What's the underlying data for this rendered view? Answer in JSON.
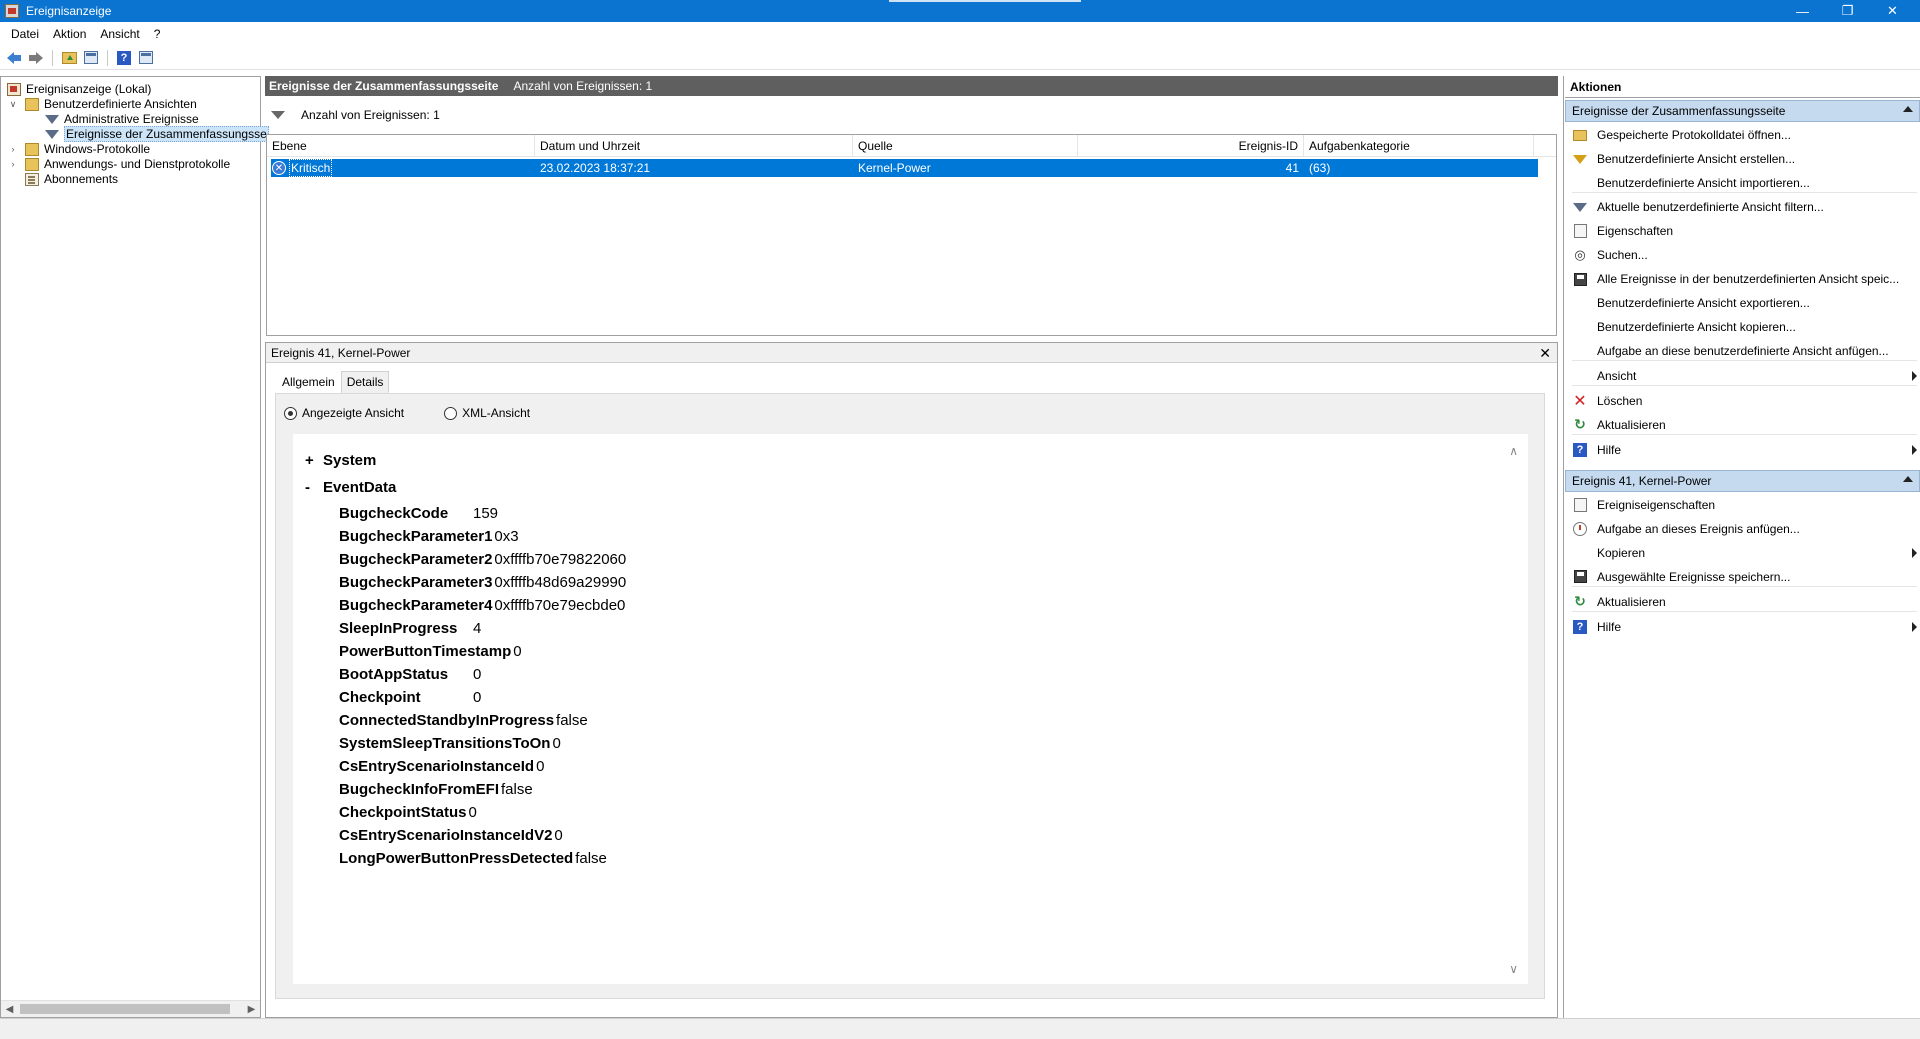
{
  "window": {
    "title": "Ereignisanzeige",
    "controls": {
      "minimize": "—",
      "maximize": "❐",
      "close": "✕"
    }
  },
  "menu": [
    "Datei",
    "Aktion",
    "Ansicht",
    "?"
  ],
  "tree": {
    "items": [
      {
        "label": "Ereignisanzeige (Lokal)",
        "icon": "computer-icon"
      },
      {
        "label": "Benutzerdefinierte Ansichten",
        "icon": "folder-icon",
        "expanded": true
      },
      {
        "label": "Administrative Ereignisse",
        "icon": "filter-icon"
      },
      {
        "label": "Ereignisse der Zusammenfassungsse",
        "icon": "filter-icon",
        "selected": true
      },
      {
        "label": "Windows-Protokolle",
        "icon": "folder-icon"
      },
      {
        "label": "Anwendungs- und Dienstprotokolle",
        "icon": "folder-icon"
      },
      {
        "label": "Abonnements",
        "icon": "log-icon"
      }
    ]
  },
  "center": {
    "header_title": "Ereignisse der Zusammenfassungsseite",
    "header_count": "Anzahl von Ereignissen: 1",
    "filter_text": "Anzahl von Ereignissen: 1",
    "columns": [
      "Ebene",
      "Datum und Uhrzeit",
      "Quelle",
      "Ereignis-ID",
      "Aufgabenkategorie"
    ],
    "rows": [
      {
        "level": "Kritisch",
        "datetime": "23.02.2023 18:37:21",
        "source": "Kernel-Power",
        "event_id": "41",
        "category": "(63)"
      }
    ]
  },
  "detail": {
    "title": "Ereignis 41, Kernel-Power",
    "tabs": [
      "Allgemein",
      "Details"
    ],
    "active_tab": "Details",
    "radio_friendly": "Angezeigte Ansicht",
    "radio_xml": "XML-Ansicht",
    "section_system": {
      "symbol": "+",
      "label": "System"
    },
    "section_eventdata": {
      "symbol": "-",
      "label": "EventData"
    },
    "eventdata": [
      {
        "key": "BugcheckCode",
        "value": "159"
      },
      {
        "key": "BugcheckParameter1",
        "value": "0x3"
      },
      {
        "key": "BugcheckParameter2",
        "value": "0xffffb70e79822060"
      },
      {
        "key": "BugcheckParameter3",
        "value": "0xffffb48d69a29990"
      },
      {
        "key": "BugcheckParameter4",
        "value": "0xffffb70e79ecbde0"
      },
      {
        "key": "SleepInProgress",
        "value": "4"
      },
      {
        "key": "PowerButtonTimestamp",
        "value": "0"
      },
      {
        "key": "BootAppStatus",
        "value": "0"
      },
      {
        "key": "Checkpoint",
        "value": "0"
      },
      {
        "key": "ConnectedStandbyInProgress",
        "value": "false"
      },
      {
        "key": "SystemSleepTransitionsToOn",
        "value": "0"
      },
      {
        "key": "CsEntryScenarioInstanceId",
        "value": "0"
      },
      {
        "key": "BugcheckInfoFromEFI",
        "value": "false"
      },
      {
        "key": "CheckpointStatus",
        "value": "0"
      },
      {
        "key": "CsEntryScenarioInstanceIdV2",
        "value": "0"
      },
      {
        "key": "LongPowerButtonPressDetected",
        "value": "false"
      }
    ]
  },
  "actions": {
    "title": "Aktionen",
    "section1": {
      "label": "Ereignisse der Zusammenfassungsseite",
      "items": [
        {
          "label": "Gespeicherte Protokolldatei öffnen...",
          "icon": "open-log-icon"
        },
        {
          "label": "Benutzerdefinierte Ansicht erstellen...",
          "icon": "create-view-icon"
        },
        {
          "label": "Benutzerdefinierte Ansicht importieren...",
          "icon": ""
        },
        {
          "label": "Aktuelle benutzerdefinierte Ansicht filtern...",
          "icon": "filter-icon"
        },
        {
          "label": "Eigenschaften",
          "icon": "properties-icon"
        },
        {
          "label": "Suchen...",
          "icon": "binoculars-icon"
        },
        {
          "label": "Alle Ereignisse in der benutzerdefinierten Ansicht speic...",
          "icon": "save-icon"
        },
        {
          "label": "Benutzerdefinierte Ansicht exportieren...",
          "icon": ""
        },
        {
          "label": "Benutzerdefinierte Ansicht kopieren...",
          "icon": ""
        },
        {
          "label": "Aufgabe an diese benutzerdefinierte Ansicht anfügen...",
          "icon": ""
        },
        {
          "label": "Ansicht",
          "icon": "",
          "submenu": true
        },
        {
          "label": "Löschen",
          "icon": "delete-icon"
        },
        {
          "label": "Aktualisieren",
          "icon": "refresh-icon"
        },
        {
          "label": "Hilfe",
          "icon": "help-icon",
          "submenu": true
        }
      ]
    },
    "section2": {
      "label": "Ereignis 41, Kernel-Power",
      "items": [
        {
          "label": "Ereigniseigenschaften",
          "icon": "properties-icon"
        },
        {
          "label": "Aufgabe an dieses Ereignis anfügen...",
          "icon": "attach-task-icon"
        },
        {
          "label": "Kopieren",
          "icon": "",
          "submenu": true
        },
        {
          "label": "Ausgewählte Ereignisse speichern...",
          "icon": "save-icon"
        },
        {
          "label": "Aktualisieren",
          "icon": "refresh-icon"
        },
        {
          "label": "Hilfe",
          "icon": "help-icon",
          "submenu": true
        }
      ]
    }
  }
}
